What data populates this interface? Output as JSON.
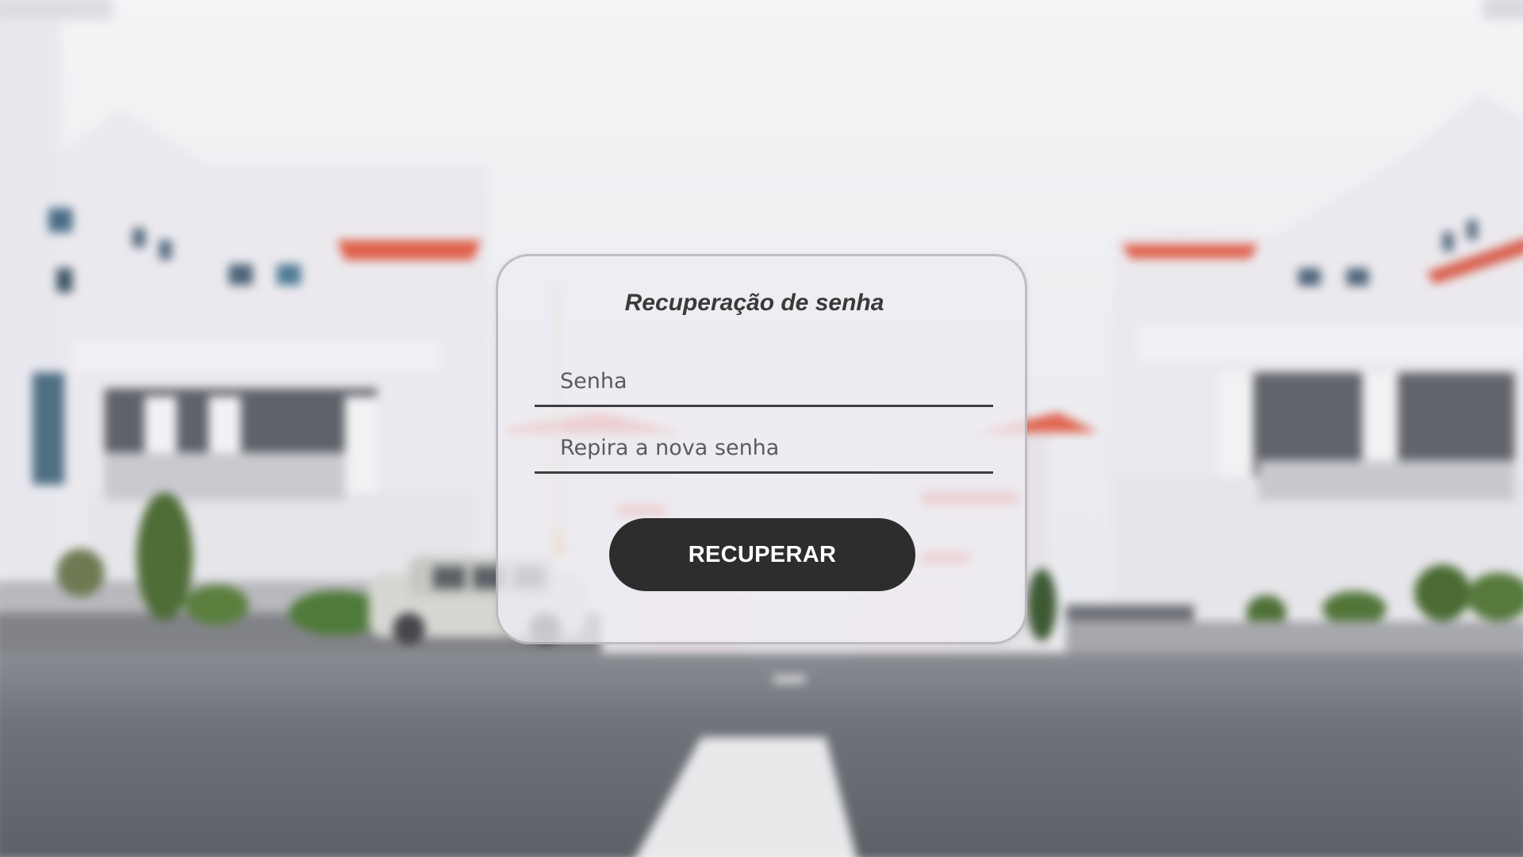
{
  "recovery_form": {
    "title": "Recuperação de senha",
    "password_placeholder": "Senha",
    "repeat_password_placeholder": "Repira a nova senha",
    "submit_label": "RECUPERAR"
  },
  "colors": {
    "button_background": "#2d2d2d",
    "button_text": "#ffffff",
    "title_text": "#3a3a3a",
    "input_underline": "#3d3d3d"
  }
}
